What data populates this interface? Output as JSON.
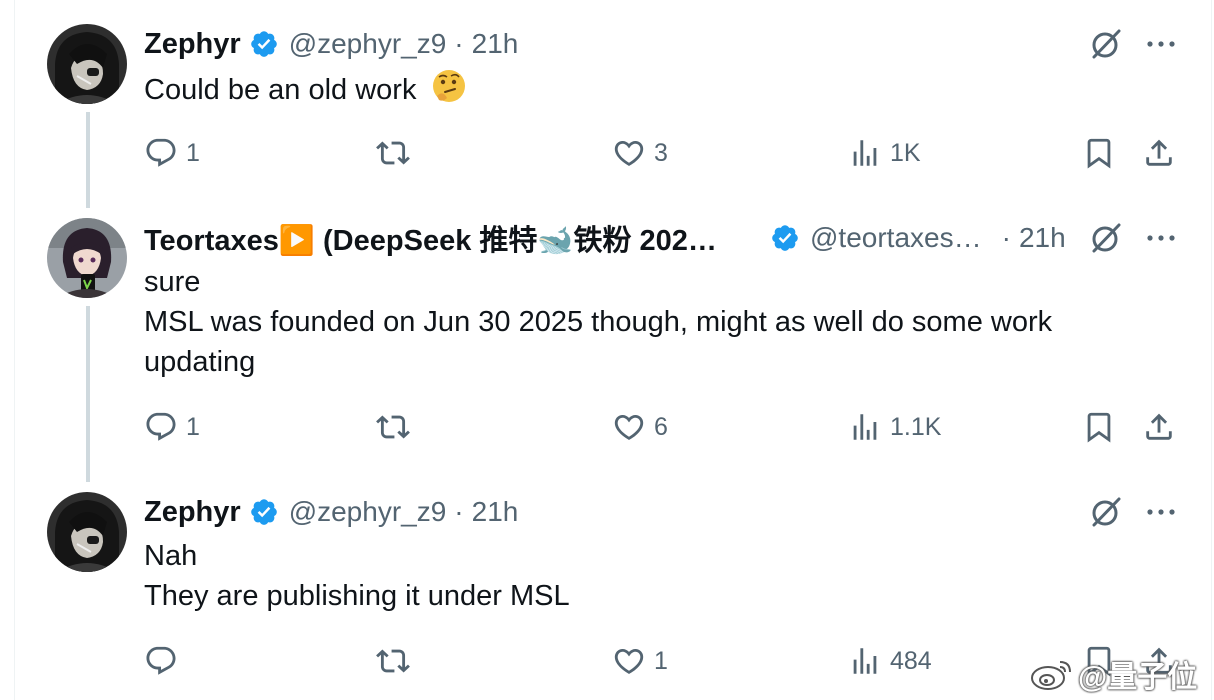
{
  "tweets": [
    {
      "name": "Zephyr",
      "handle": "@zephyr_z9",
      "separator": "·",
      "time": "21h",
      "lines": [
        "Could be an old work"
      ],
      "emoji": "🤔",
      "replies": "1",
      "reposts": "",
      "likes": "3",
      "views": "1K"
    },
    {
      "name": "Teortaxes▶️ (DeepSeek 推特🐋铁粉 202…",
      "handle": "@teortaxes…",
      "separator": "·",
      "time": "21h",
      "lines": [
        "sure",
        "MSL was founded on Jun 30 2025 though, might as well do some work",
        "updating"
      ],
      "emoji": "",
      "replies": "1",
      "reposts": "",
      "likes": "6",
      "views": "1.1K"
    },
    {
      "name": "Zephyr",
      "handle": "@zephyr_z9",
      "separator": "·",
      "time": "21h",
      "lines": [
        "Nah",
        "They are publishing it under MSL"
      ],
      "emoji": "",
      "replies": "",
      "reposts": "",
      "likes": "1",
      "views": "484"
    }
  ],
  "watermark": {
    "text": "@量子位",
    "icon": "weibo-icon"
  },
  "colors": {
    "text_primary": "#0f1419",
    "text_secondary": "#536471",
    "verified_blue": "#1d9bf0",
    "thread_line": "#cfd9de"
  },
  "icons": [
    "reply-icon",
    "repost-icon",
    "like-icon",
    "views-icon",
    "bookmark-icon",
    "share-icon",
    "grok-icon",
    "more-icon",
    "verified-badge-icon"
  ]
}
